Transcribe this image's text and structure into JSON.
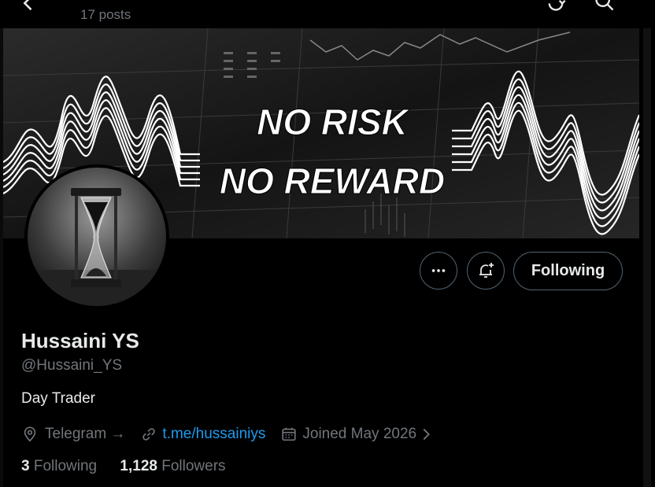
{
  "header": {
    "posts_count": "17 posts"
  },
  "banner": {
    "line1": "NO RISK",
    "line2": "NO REWARD"
  },
  "actions": {
    "following_label": "Following"
  },
  "profile": {
    "display_name": "Hussaini YS",
    "handle": "@Hussaini_YS",
    "bio": "Day Trader",
    "location": "Telegram →",
    "link": "t.me/hussainiys",
    "joined": "Joined May 2026"
  },
  "stats": {
    "following_count": "3",
    "following_label": "Following",
    "followers_count": "1,128",
    "followers_label": "Followers"
  },
  "colors": {
    "background": "#000000",
    "text_primary": "#e7e9ea",
    "text_secondary": "#71767b",
    "link": "#1d9bf0",
    "border": "#536471"
  },
  "icons": [
    "back-arrow-icon",
    "retweet-icon",
    "search-icon",
    "more-icon",
    "notification-bell-icon",
    "location-icon",
    "link-icon",
    "calendar-icon",
    "chevron-right-icon"
  ]
}
